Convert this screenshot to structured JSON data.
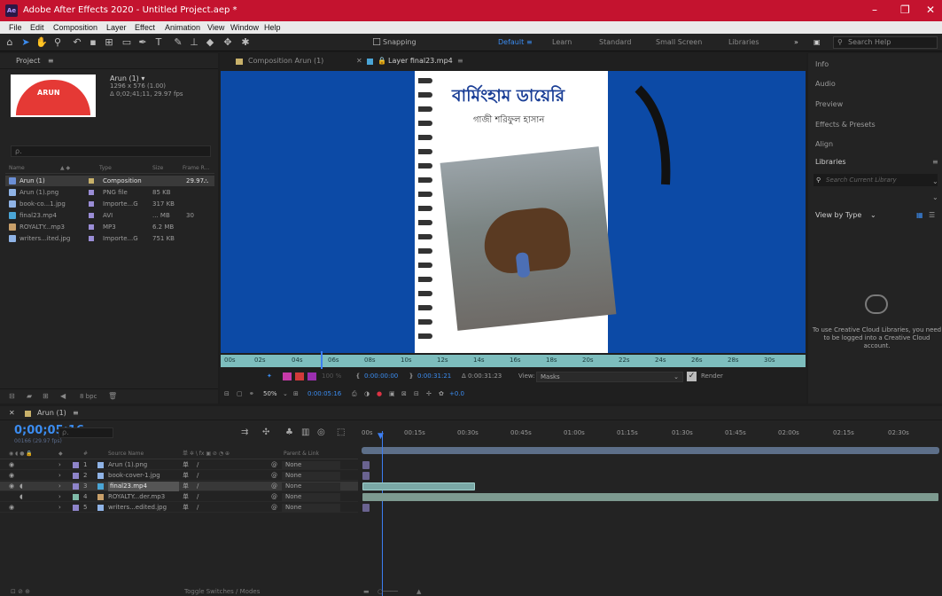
{
  "app": {
    "icon_text": "Ae",
    "title": "Adobe After Effects 2020 - Untitled Project.aep *",
    "window_controls": {
      "minimize": "–",
      "restore": "❐",
      "close": "✕"
    }
  },
  "menu": [
    "File",
    "Edit",
    "Composition",
    "Layer",
    "Effect",
    "Animation",
    "View",
    "Window",
    "Help"
  ],
  "toolbar": {
    "snapping_label": "Snapping",
    "workspaces": [
      "Default",
      "Learn",
      "Standard",
      "Small Screen",
      "Libraries"
    ],
    "active_workspace": "Default",
    "more": "»",
    "search_placeholder": "Search Help"
  },
  "project": {
    "header": "Project",
    "comp_name": "Arun (1) ▾",
    "comp_dims": "1296 x 576 (1.00)",
    "comp_duration": "Δ 0;02;41;11, 29.97 fps",
    "thumb_title": "ARUN",
    "search_placeholder": "ρ.",
    "columns": {
      "name": "Name",
      "type": "Type",
      "size": "Size",
      "frame_rate": "Frame R..."
    },
    "items": [
      {
        "name": "Arun (1)",
        "type": "Composition",
        "size": "",
        "fps": "29.97",
        "icon_color": "#6b8fd6",
        "swatch": "#c8b16a"
      },
      {
        "name": "Arun (1).png",
        "type": "PNG file",
        "size": "85 KB",
        "fps": "",
        "icon_color": "#8fb3e6",
        "swatch": "#9a8dd6"
      },
      {
        "name": "book-co...1.jpg",
        "type": "Importe...G",
        "size": "317 KB",
        "fps": "",
        "icon_color": "#8fb3e6",
        "swatch": "#9a8dd6"
      },
      {
        "name": "final23.mp4",
        "type": "AVI",
        "size": "... MB",
        "fps": "30",
        "icon_color": "#4aa5d6",
        "swatch": "#9a8dd6"
      },
      {
        "name": "ROYALTY...mp3",
        "type": "MP3",
        "size": "6.2 MB",
        "fps": "",
        "icon_color": "#c9a06a",
        "swatch": "#9a8dd6"
      },
      {
        "name": "writers...ited.jpg",
        "type": "Importe...G",
        "size": "751 KB",
        "fps": "",
        "icon_color": "#8fb3e6",
        "swatch": "#9a8dd6"
      }
    ],
    "footer_bpc": "8 bpc"
  },
  "viewer": {
    "tabs": [
      {
        "label": "Composition Arun (1)",
        "active": false
      },
      {
        "label": "Layer final23.mp4",
        "active": true
      }
    ],
    "book_title": "বার্মিংহাম ডায়েরি",
    "book_author": "গাজী শরিফুল হাসান",
    "ruler_ticks": [
      "00s",
      "02s",
      "04s",
      "06s",
      "08s",
      "10s",
      "12s",
      "14s",
      "16s",
      "18s",
      "20s",
      "22s",
      "24s",
      "26s",
      "28s",
      "30s"
    ],
    "zoom_percent": "100 %",
    "in_point": "0:00:00:00",
    "out_point": "0:00:31:21",
    "duration": "Δ 0:00:31:23",
    "view_label": "View:",
    "view_value": "Masks",
    "render_label": "Render",
    "magnification": "50%",
    "current_time": "0:00:05:16",
    "exposure": "+0.0"
  },
  "right_panel": {
    "items": [
      "Info",
      "Audio",
      "Preview",
      "Effects & Presets",
      "Align",
      "Libraries"
    ],
    "library_search_placeholder": "Search Current Library",
    "view_by": "View by Type",
    "cc_message": "To use Creative Cloud Libraries, you need to be logged into a Creative Cloud account."
  },
  "timeline": {
    "tab_label": "Arun (1)",
    "timecode": "0;00;05;16",
    "fps_label": "00166 (29.97 fps)",
    "search_placeholder": "ρ.",
    "columns": {
      "source_name": "Source Name",
      "switches": "单 ✲ \\ fx ▣ ⊘ ◔ ⊕",
      "parent": "Parent & Link"
    },
    "layers": [
      {
        "num": "1",
        "name": "Arun (1).png",
        "parent": "None",
        "chip": "#8e84c9",
        "icon": "#8fb3e6"
      },
      {
        "num": "2",
        "name": "book-cover-1.jpg",
        "parent": "None",
        "chip": "#8e84c9",
        "icon": "#8fb3e6"
      },
      {
        "num": "3",
        "name": "final23.mp4",
        "parent": "None",
        "chip": "#8e84c9",
        "icon": "#4aa5d6"
      },
      {
        "num": "4",
        "name": "ROYALTY...der.mp3",
        "parent": "None",
        "chip": "#7fbba8",
        "icon": "#c9a06a"
      },
      {
        "num": "5",
        "name": "writers...edited.jpg",
        "parent": "None",
        "chip": "#8e84c9",
        "icon": "#8fb3e6"
      }
    ],
    "ruler_ticks": [
      "00s",
      "00:15s",
      "00:30s",
      "00:45s",
      "01:00s",
      "01:15s",
      "01:30s",
      "01:45s",
      "02:00s",
      "02:15s",
      "02:30s"
    ],
    "footer_label": "Toggle Switches / Modes"
  }
}
